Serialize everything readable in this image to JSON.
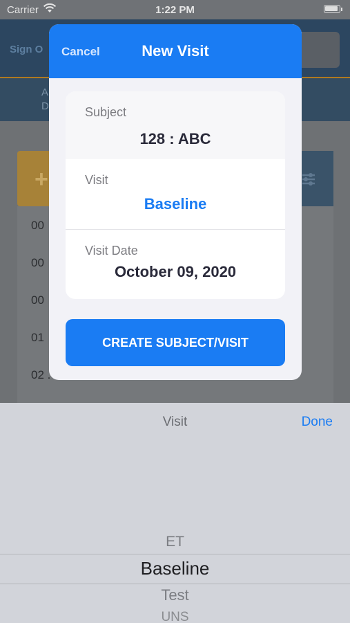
{
  "status": {
    "carrier": "Carrier",
    "time": "1:22 PM"
  },
  "background": {
    "sign_out_partial": "Sign O",
    "subheader_line1": "A",
    "subheader_line2": "D",
    "rows": [
      "00",
      "00",
      "00",
      "01",
      "02 ."
    ]
  },
  "modal": {
    "cancel_label": "Cancel",
    "title": "New Visit",
    "subject_label": "Subject",
    "subject_value": "128 : ABC",
    "visit_label": "Visit",
    "visit_value": "Baseline",
    "visit_date_label": "Visit Date",
    "visit_date_value": "October 09, 2020",
    "create_button": "CREATE SUBJECT/VISIT"
  },
  "picker": {
    "title": "Visit",
    "done_label": "Done",
    "options": [
      "ET",
      "Baseline",
      "Test",
      "UNS"
    ],
    "selected": "Baseline"
  },
  "colors": {
    "accent": "#1a7cf3",
    "header": "#2c4660"
  },
  "icons": [
    "wifi-icon",
    "battery-icon",
    "plus-icon",
    "filter-icon"
  ]
}
